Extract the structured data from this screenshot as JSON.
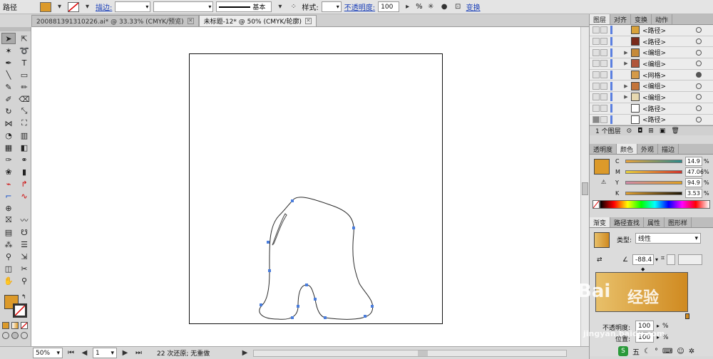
{
  "control_bar": {
    "selection_label": "路径",
    "stroke_label": "描边:",
    "stroke_profile": "基本",
    "style_label": "样式:",
    "opacity_label": "不透明度:",
    "opacity_value": "100",
    "opacity_unit": "%",
    "transform_label": "变换"
  },
  "tabs": [
    {
      "label": "200881391310226.ai* @ 33.33% (CMYK/预览)"
    },
    {
      "label": "未标题-12* @ 50% (CMYK/轮廓)"
    }
  ],
  "tab_close_glyph": "✕",
  "status_bar": {
    "zoom": "50%",
    "page": "1",
    "history": "22 次还原; 无重做"
  },
  "layers_panel": {
    "tabs": [
      "图层",
      "对齐",
      "变换",
      "动作"
    ],
    "rows": [
      {
        "name": "<路径>",
        "thumb_color": "#d9a23a",
        "triangle": ""
      },
      {
        "name": "<路径>",
        "thumb_color": "#7a2a1a",
        "triangle": ""
      },
      {
        "name": "<编组>",
        "thumb_color": "#c58a3a",
        "triangle": "▶"
      },
      {
        "name": "<编组>",
        "thumb_color": "#b0553a",
        "triangle": "▶"
      },
      {
        "name": "<网格>",
        "thumb_color": "#d49a48",
        "triangle": ""
      },
      {
        "name": "<编组>",
        "thumb_color": "#c4753a",
        "triangle": "▶"
      },
      {
        "name": "<编组>",
        "thumb_color": "#e6d8b0",
        "triangle": "▶"
      },
      {
        "name": "<路径>",
        "thumb_color": "#ffffff",
        "triangle": ""
      },
      {
        "name": "<路径>",
        "thumb_color": "#ffffff",
        "triangle": ""
      }
    ],
    "footer": "1 个图层"
  },
  "color_panel": {
    "tabs": [
      "透明度",
      "颜色",
      "外观",
      "描边"
    ],
    "fill_color": "#dc9a2a",
    "sliders": [
      {
        "label": "C",
        "value": "14.9"
      },
      {
        "label": "M",
        "value": "47.06"
      },
      {
        "label": "Y",
        "value": "94.9"
      },
      {
        "label": "K",
        "value": "3.53"
      }
    ],
    "unit": "%"
  },
  "gradient_panel": {
    "tabs": [
      "渐变",
      "路径查找",
      "属性",
      "图形样"
    ],
    "type_label": "类型:",
    "type_value": "线性",
    "angle_value": "-88.4",
    "gradient_start": "#e8c06a",
    "gradient_end": "#d08a20",
    "opacity_label": "不透明度:",
    "opacity_value": "100",
    "location_label": "位置:",
    "location_value": "100",
    "unit": "%"
  },
  "watermark": {
    "line1": "Bai",
    "line2": "经验",
    "url": "jingyan.baidu.com"
  },
  "taskbar": {
    "ime": "五"
  }
}
